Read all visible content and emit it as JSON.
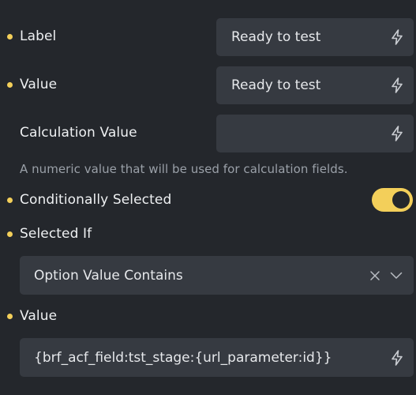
{
  "fields": {
    "label": {
      "label": "Label",
      "value": "Ready to test",
      "icon": "bolt-icon"
    },
    "value": {
      "label": "Value",
      "value": "Ready to test",
      "icon": "bolt-icon"
    },
    "calculation_value": {
      "label": "Calculation Value",
      "value": "",
      "help": "A numeric value that will be used for calculation fields.",
      "icon": "bolt-icon"
    },
    "conditionally_selected": {
      "label": "Conditionally Selected",
      "checked": true
    },
    "selected_if": {
      "label": "Selected If",
      "selected": "Option Value Contains"
    },
    "value2": {
      "label": "Value",
      "value": "{brf_acf_field:tst_stage:{url_parameter:id}}",
      "icon": "bolt-icon"
    }
  },
  "colors": {
    "background": "#24272c",
    "input": "#363a41",
    "accent": "#f3cf5a",
    "muted_text": "#9aa0a8"
  }
}
